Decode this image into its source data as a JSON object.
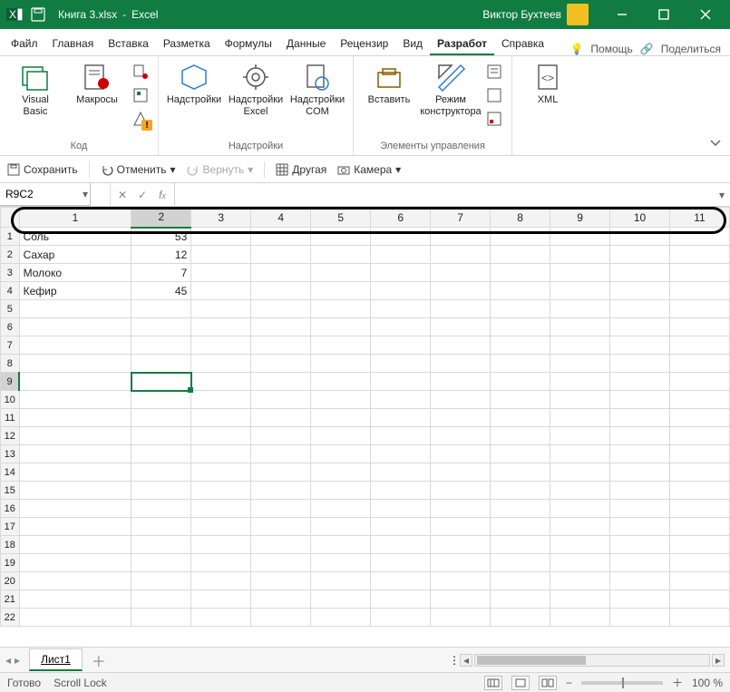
{
  "titlebar": {
    "file": "Книга 3.xlsx",
    "app": "Excel",
    "user": "Виктор Бухтеев"
  },
  "tabs": {
    "items": [
      "Файл",
      "Главная",
      "Вставка",
      "Разметка",
      "Формулы",
      "Данные",
      "Рецензир",
      "Вид",
      "Разработ",
      "Справка"
    ],
    "help": "Помощь",
    "share": "Поделиться",
    "selected": 8
  },
  "ribbon": {
    "groups": [
      {
        "name": "Код",
        "big": [
          {
            "label": "Visual\nBasic"
          },
          {
            "label": "Макросы"
          }
        ]
      },
      {
        "name": "Надстройки",
        "big": [
          {
            "label": "Надстройки"
          },
          {
            "label": "Надстройки\nExcel"
          },
          {
            "label": "Надстройки\nCOM"
          }
        ]
      },
      {
        "name": "Элементы управления",
        "big": [
          {
            "label": "Вставить"
          },
          {
            "label": "Режим\nконструктора"
          }
        ]
      },
      {
        "name": "",
        "big": [
          {
            "label": "XML"
          }
        ]
      }
    ]
  },
  "qat": {
    "save": "Сохранить",
    "undo": "Отменить",
    "redo": "Вернуть",
    "other": "Другая",
    "camera": "Камера"
  },
  "fx": {
    "name": "R9C2"
  },
  "columns": [
    "1",
    "2",
    "3",
    "4",
    "5",
    "6",
    "7",
    "8",
    "9",
    "10",
    "11"
  ],
  "rows": [
    {
      "n": "1",
      "c": [
        "Соль",
        "53",
        "",
        "",
        "",
        "",
        "",
        "",
        "",
        "",
        ""
      ]
    },
    {
      "n": "2",
      "c": [
        "Сахар",
        "12",
        "",
        "",
        "",
        "",
        "",
        "",
        "",
        "",
        ""
      ]
    },
    {
      "n": "3",
      "c": [
        "Молоко",
        "7",
        "",
        "",
        "",
        "",
        "",
        "",
        "",
        "",
        ""
      ]
    },
    {
      "n": "4",
      "c": [
        "Кефир",
        "45",
        "",
        "",
        "",
        "",
        "",
        "",
        "",
        "",
        ""
      ]
    },
    {
      "n": "5",
      "c": [
        "",
        "",
        "",
        "",
        "",
        "",
        "",
        "",
        "",
        "",
        ""
      ]
    },
    {
      "n": "6",
      "c": [
        "",
        "",
        "",
        "",
        "",
        "",
        "",
        "",
        "",
        "",
        ""
      ]
    },
    {
      "n": "7",
      "c": [
        "",
        "",
        "",
        "",
        "",
        "",
        "",
        "",
        "",
        "",
        ""
      ]
    },
    {
      "n": "8",
      "c": [
        "",
        "",
        "",
        "",
        "",
        "",
        "",
        "",
        "",
        "",
        ""
      ]
    },
    {
      "n": "9",
      "c": [
        "",
        "",
        "",
        "",
        "",
        "",
        "",
        "",
        "",
        "",
        ""
      ]
    },
    {
      "n": "10",
      "c": [
        "",
        "",
        "",
        "",
        "",
        "",
        "",
        "",
        "",
        "",
        ""
      ]
    },
    {
      "n": "11",
      "c": [
        "",
        "",
        "",
        "",
        "",
        "",
        "",
        "",
        "",
        "",
        ""
      ]
    },
    {
      "n": "12",
      "c": [
        "",
        "",
        "",
        "",
        "",
        "",
        "",
        "",
        "",
        "",
        ""
      ]
    },
    {
      "n": "13",
      "c": [
        "",
        "",
        "",
        "",
        "",
        "",
        "",
        "",
        "",
        "",
        ""
      ]
    },
    {
      "n": "14",
      "c": [
        "",
        "",
        "",
        "",
        "",
        "",
        "",
        "",
        "",
        "",
        ""
      ]
    },
    {
      "n": "15",
      "c": [
        "",
        "",
        "",
        "",
        "",
        "",
        "",
        "",
        "",
        "",
        ""
      ]
    },
    {
      "n": "16",
      "c": [
        "",
        "",
        "",
        "",
        "",
        "",
        "",
        "",
        "",
        "",
        ""
      ]
    },
    {
      "n": "17",
      "c": [
        "",
        "",
        "",
        "",
        "",
        "",
        "",
        "",
        "",
        "",
        ""
      ]
    },
    {
      "n": "18",
      "c": [
        "",
        "",
        "",
        "",
        "",
        "",
        "",
        "",
        "",
        "",
        ""
      ]
    },
    {
      "n": "19",
      "c": [
        "",
        "",
        "",
        "",
        "",
        "",
        "",
        "",
        "",
        "",
        ""
      ]
    },
    {
      "n": "20",
      "c": [
        "",
        "",
        "",
        "",
        "",
        "",
        "",
        "",
        "",
        "",
        ""
      ]
    },
    {
      "n": "21",
      "c": [
        "",
        "",
        "",
        "",
        "",
        "",
        "",
        "",
        "",
        "",
        ""
      ]
    },
    {
      "n": "22",
      "c": [
        "",
        "",
        "",
        "",
        "",
        "",
        "",
        "",
        "",
        "",
        ""
      ]
    }
  ],
  "selected": {
    "row": 8,
    "col": 1
  },
  "sheet": {
    "name": "Лист1"
  },
  "status": {
    "ready": "Готово",
    "scroll": "Scroll Lock",
    "zoom": "100 %"
  }
}
